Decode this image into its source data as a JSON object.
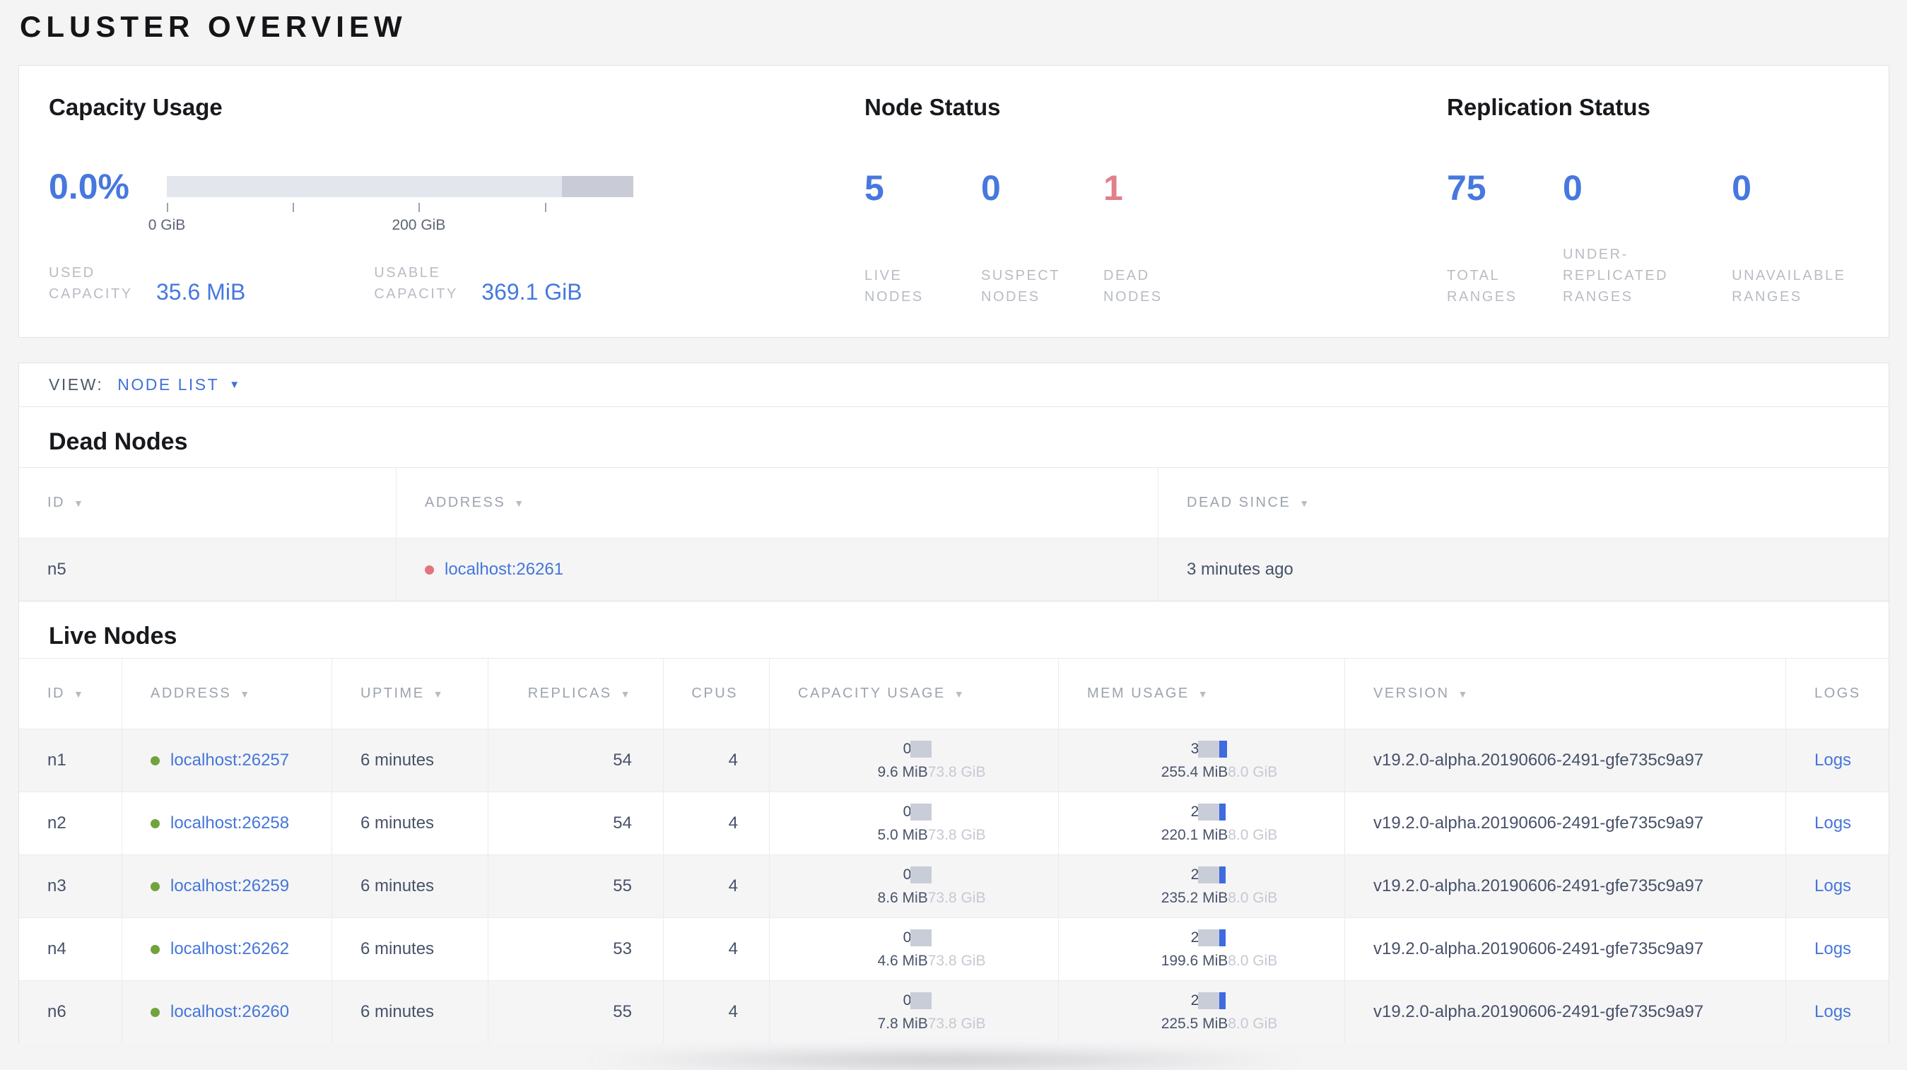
{
  "page": {
    "title": "CLUSTER OVERVIEW"
  },
  "icons": {
    "sort_arrow": "▼",
    "dropdown_caret": "▼"
  },
  "colors": {
    "accent_blue": "#4678de",
    "dead_red": "#e27e8d",
    "live_dot_green": "#71a33c",
    "dead_dot_red": "#e2737f"
  },
  "overview": {
    "capacity": {
      "title": "Capacity Usage",
      "percent": "0.0%",
      "tick_labels": [
        {
          "text": "0 GiB",
          "pos": 0.0
        },
        {
          "text": "200 GiB",
          "pos": 0.54
        }
      ],
      "tick_positions": [
        0.0,
        0.27,
        0.54,
        0.81
      ],
      "used": {
        "label": "USED CAPACITY",
        "value": "35.6 MiB"
      },
      "usable": {
        "label": "USABLE CAPACITY",
        "value": "369.1 GiB"
      }
    },
    "node_status": {
      "title": "Node Status",
      "stats": [
        {
          "value": "5",
          "label": "LIVE NODES",
          "color": "#4678de"
        },
        {
          "value": "0",
          "label": "SUSPECT NODES",
          "color": "#4678de"
        },
        {
          "value": "1",
          "label": "DEAD NODES",
          "color": "#e27e8d"
        }
      ]
    },
    "replication_status": {
      "title": "Replication Status",
      "stats": [
        {
          "value": "75",
          "label": "TOTAL RANGES",
          "color": "#4678de"
        },
        {
          "value": "0",
          "label": "UNDER-REPLICATED RANGES",
          "color": "#4678de"
        },
        {
          "value": "0",
          "label": "UNAVAILABLE RANGES",
          "color": "#4678de"
        }
      ]
    }
  },
  "view_bar": {
    "label": "VIEW:",
    "selected": "NODE LIST"
  },
  "dead_nodes": {
    "heading": "Dead Nodes",
    "columns": [
      {
        "label": "ID",
        "sortable": true
      },
      {
        "label": "ADDRESS",
        "sortable": true
      },
      {
        "label": "DEAD SINCE",
        "sortable": true
      }
    ],
    "rows": [
      {
        "id": "n5",
        "address": "localhost:26261",
        "dead_since": "3 minutes ago"
      }
    ]
  },
  "live_nodes": {
    "heading": "Live Nodes",
    "columns": [
      {
        "label": "ID",
        "sortable": true
      },
      {
        "label": "ADDRESS",
        "sortable": true
      },
      {
        "label": "UPTIME",
        "sortable": true
      },
      {
        "label": "REPLICAS",
        "sortable": true
      },
      {
        "label": "CPUS",
        "sortable": false
      },
      {
        "label": "CAPACITY USAGE",
        "sortable": true
      },
      {
        "label": "MEM USAGE",
        "sortable": true
      },
      {
        "label": "VERSION",
        "sortable": true
      },
      {
        "label": "LOGS",
        "sortable": false
      }
    ],
    "rows": [
      {
        "id": "n1",
        "address": "localhost:26257",
        "uptime": "6 minutes",
        "replicas": "54",
        "cpus": "4",
        "capacity": {
          "percent": "0%",
          "pct": 0,
          "used": "9.6 MiB",
          "total": "73.8 GiB"
        },
        "mem": {
          "percent": "3%",
          "pct": 3,
          "used": "255.4 MiB",
          "total": "8.0 GiB"
        },
        "version": "v19.2.0-alpha.20190606-2491-gfe735c9a97",
        "logs": "Logs"
      },
      {
        "id": "n2",
        "address": "localhost:26258",
        "uptime": "6 minutes",
        "replicas": "54",
        "cpus": "4",
        "capacity": {
          "percent": "0%",
          "pct": 0,
          "used": "5.0 MiB",
          "total": "73.8 GiB"
        },
        "mem": {
          "percent": "2%",
          "pct": 2,
          "used": "220.1 MiB",
          "total": "8.0 GiB"
        },
        "version": "v19.2.0-alpha.20190606-2491-gfe735c9a97",
        "logs": "Logs"
      },
      {
        "id": "n3",
        "address": "localhost:26259",
        "uptime": "6 minutes",
        "replicas": "55",
        "cpus": "4",
        "capacity": {
          "percent": "0%",
          "pct": 0,
          "used": "8.6 MiB",
          "total": "73.8 GiB"
        },
        "mem": {
          "percent": "2%",
          "pct": 2,
          "used": "235.2 MiB",
          "total": "8.0 GiB"
        },
        "version": "v19.2.0-alpha.20190606-2491-gfe735c9a97",
        "logs": "Logs"
      },
      {
        "id": "n4",
        "address": "localhost:26262",
        "uptime": "6 minutes",
        "replicas": "53",
        "cpus": "4",
        "capacity": {
          "percent": "0%",
          "pct": 0,
          "used": "4.6 MiB",
          "total": "73.8 GiB"
        },
        "mem": {
          "percent": "2%",
          "pct": 2,
          "used": "199.6 MiB",
          "total": "8.0 GiB"
        },
        "version": "v19.2.0-alpha.20190606-2491-gfe735c9a97",
        "logs": "Logs"
      },
      {
        "id": "n6",
        "address": "localhost:26260",
        "uptime": "6 minutes",
        "replicas": "55",
        "cpus": "4",
        "capacity": {
          "percent": "0%",
          "pct": 0,
          "used": "7.8 MiB",
          "total": "73.8 GiB"
        },
        "mem": {
          "percent": "2%",
          "pct": 2,
          "used": "225.5 MiB",
          "total": "8.0 GiB"
        },
        "version": "v19.2.0-alpha.20190606-2491-gfe735c9a97",
        "logs": "Logs"
      }
    ]
  }
}
